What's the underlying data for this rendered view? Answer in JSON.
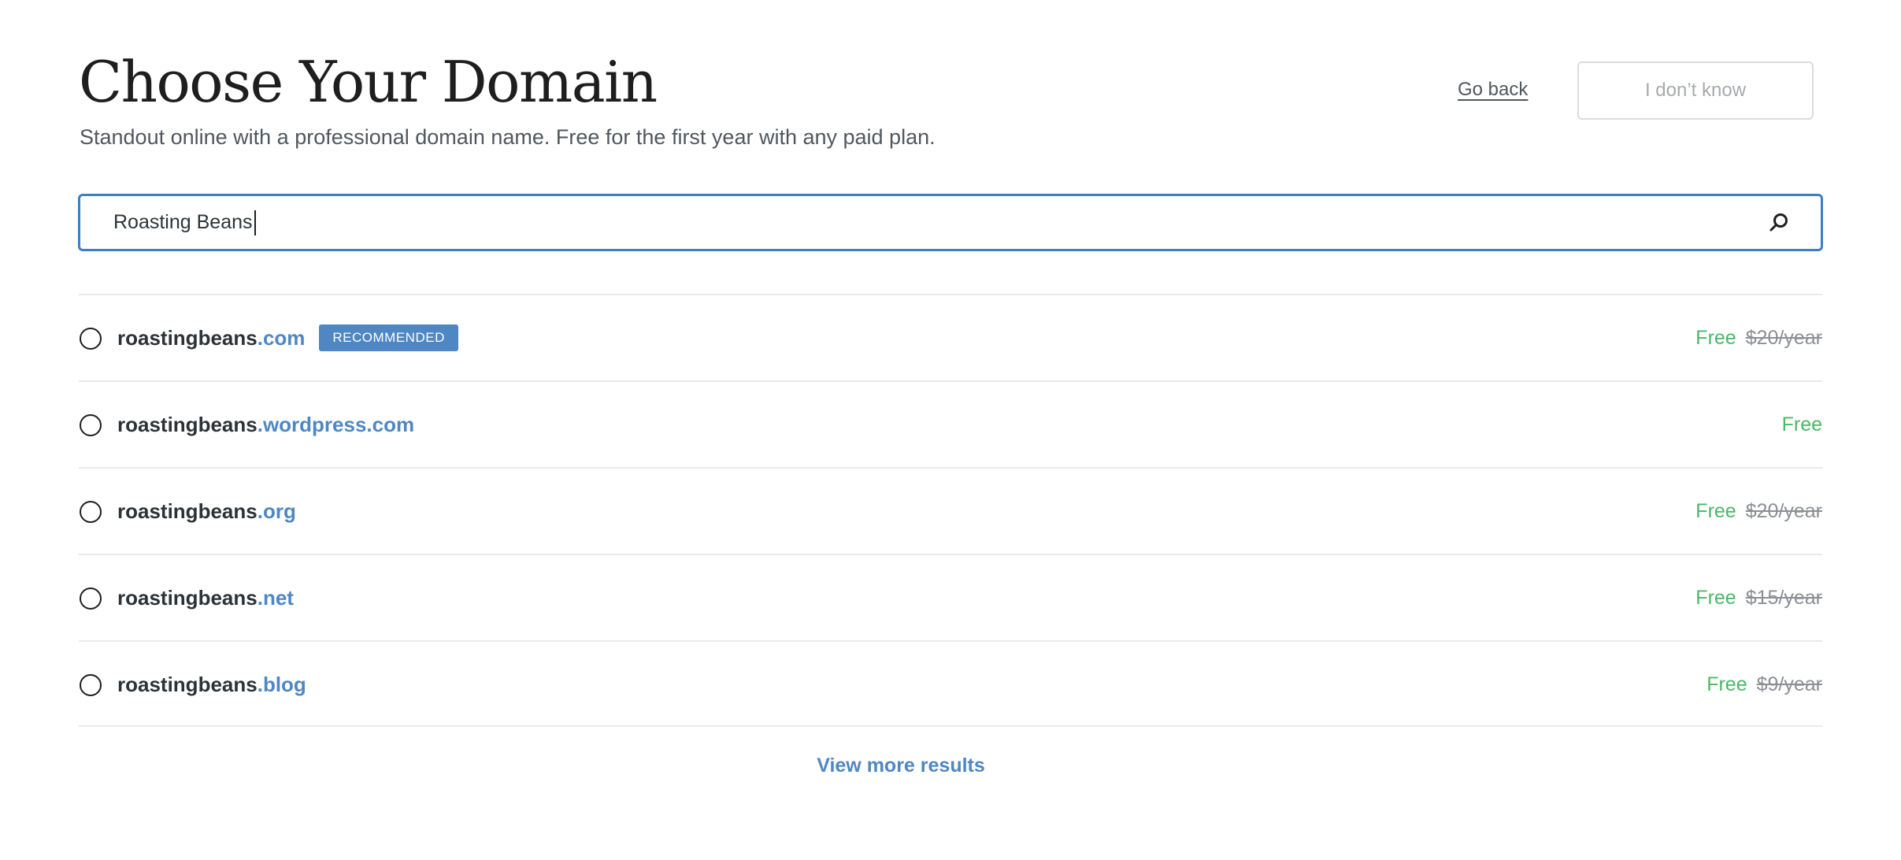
{
  "header": {
    "title": "Choose Your Domain",
    "subtitle": "Standout online with a professional domain name. Free for the first year with any paid plan.",
    "go_back_label": "Go back",
    "dont_know_label": "I don’t know"
  },
  "search": {
    "value": "Roasting Beans",
    "icon": "search-icon"
  },
  "results": [
    {
      "base": "roastingbeans",
      "tld": ".com",
      "badge": "RECOMMENDED",
      "free_label": "Free",
      "old_price": "$20/year",
      "selected": false
    },
    {
      "base": "roastingbeans",
      "tld": ".wordpress.com",
      "badge": "",
      "free_label": "Free",
      "old_price": "",
      "selected": false
    },
    {
      "base": "roastingbeans",
      "tld": ".org",
      "badge": "",
      "free_label": "Free",
      "old_price": "$20/year",
      "selected": false
    },
    {
      "base": "roastingbeans",
      "tld": ".net",
      "badge": "",
      "free_label": "Free",
      "old_price": "$15/year",
      "selected": false
    },
    {
      "base": "roastingbeans",
      "tld": ".blog",
      "badge": "",
      "free_label": "Free",
      "old_price": "$9/year",
      "selected": false
    }
  ],
  "footer": {
    "view_more_label": "View more results"
  },
  "colors": {
    "accent": "#4f87c3",
    "search_border": "#3b7fc4",
    "free_green": "#4ab866",
    "divider": "#e9e9eb"
  }
}
